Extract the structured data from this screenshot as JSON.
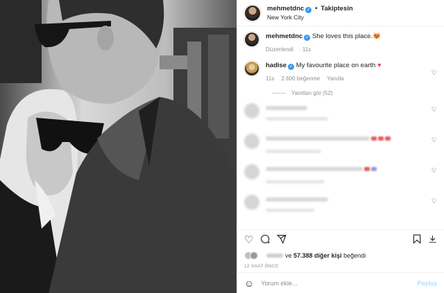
{
  "header": {
    "username": "mehmetdnc",
    "follow_label": "Takiptesin",
    "dot": "•",
    "location": "New York City"
  },
  "caption": {
    "username": "mehmetdnc",
    "text": "She loves this place.😻",
    "edited": "Düzenlendi",
    "time": "11s"
  },
  "top_comment": {
    "username": "hadise",
    "text": "My favourite place on earth",
    "time": "11s",
    "likes": "2.600 beğenme",
    "reply_label": "Yanıtla",
    "view_replies": "Yanıtları gör (52)"
  },
  "actions": {
    "like_icon": "heart-icon",
    "comment_icon": "comment-icon",
    "share_icon": "share-icon",
    "save_icon": "bookmark-icon",
    "download_icon": "download-icon"
  },
  "likes_line": {
    "prefix": "ve",
    "count_text": "57.388 diğer kişi",
    "suffix": "beğendi"
  },
  "post_time": "12 SAAT ÖNCE",
  "add_comment": {
    "placeholder": "Yorum ekle...",
    "post_label": "Paylaş"
  },
  "colors": {
    "verified": "#3897f0",
    "heart_red": "#ed4956",
    "post_disabled": "#b2dffc"
  }
}
